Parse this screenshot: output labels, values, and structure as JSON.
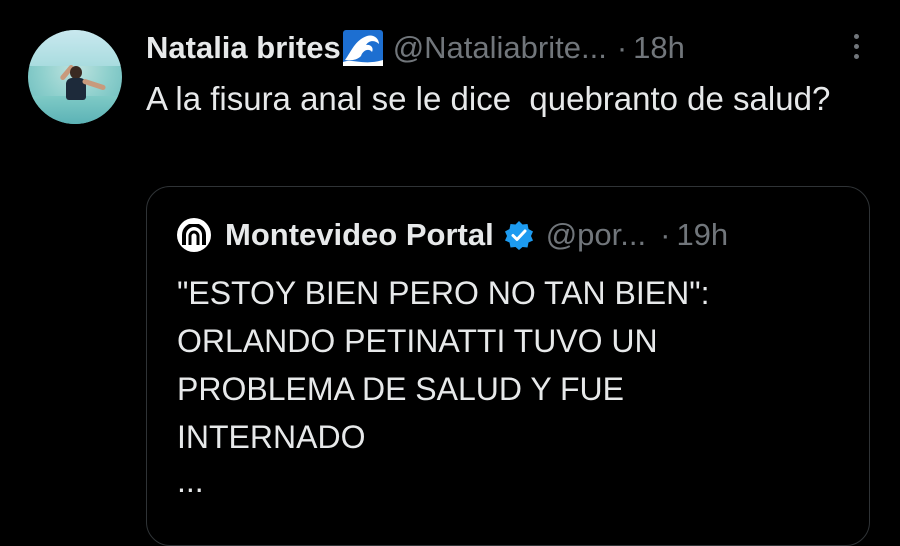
{
  "tweet": {
    "author_name": "Natalia brites",
    "author_emoji": "wave-icon",
    "handle": "@Nataliabrite...",
    "separator": "·",
    "time": "18h",
    "text": "A la fisura anal se le dice  quebranto de salud?"
  },
  "quoted": {
    "author_name": "Montevideo Portal",
    "verified": "verified-badge-icon",
    "handle": "@por...",
    "separator": "·",
    "time": "19h",
    "text_lines": [
      "\"ESTOY BIEN PERO NO TAN BIEN\":",
      "ORLANDO PETINATTI TUVO UN",
      "PROBLEMA DE SALUD Y FUE",
      "INTERNADO"
    ],
    "ellipsis": "..."
  },
  "colors": {
    "background": "#000000",
    "primary_text": "#e7e9ea",
    "secondary_text": "#71767b",
    "border": "#2f3336",
    "verified": "#1d9bf0"
  }
}
